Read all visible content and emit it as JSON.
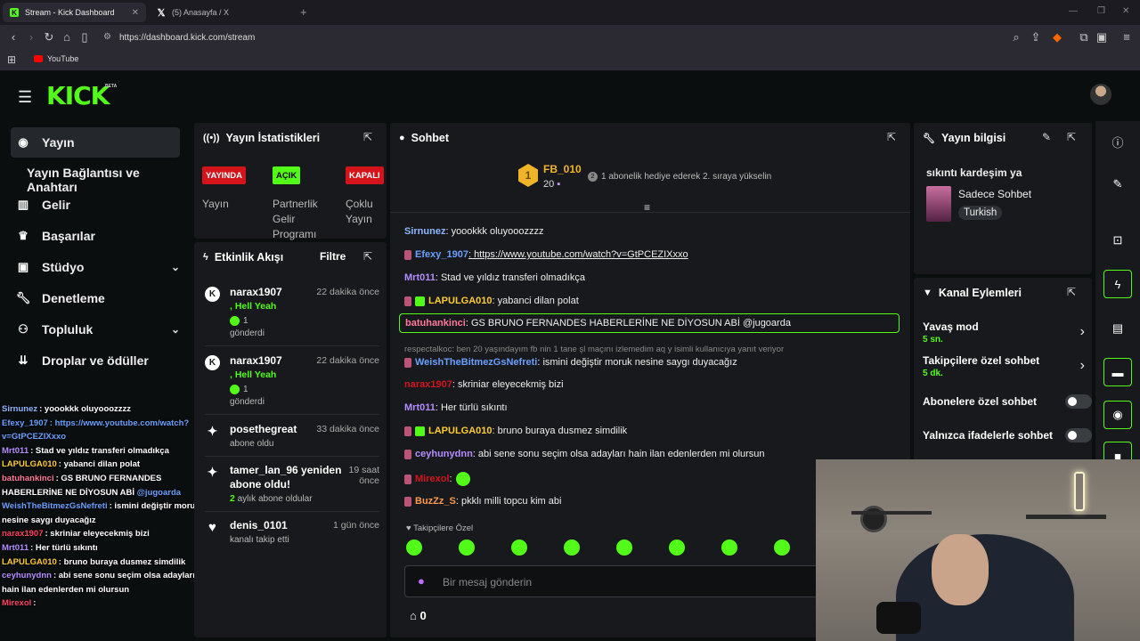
{
  "browser": {
    "tabs": [
      {
        "title": "Stream - Kick Dashboard",
        "icon": "kick-favicon"
      },
      {
        "title": "(5) Anasayfa / X",
        "icon": "x-favicon"
      }
    ],
    "url": "https://dashboard.kick.com/stream",
    "bookmark": "YouTube"
  },
  "header": {
    "logo": "KICK",
    "beta": "BETA"
  },
  "sidebar": {
    "items": [
      {
        "label": "Yayın",
        "icon": "broadcast-icon"
      },
      {
        "label": "Yayın Bağlantısı ve Anahtarı"
      },
      {
        "label": "Gelir",
        "icon": "chart-icon"
      },
      {
        "label": "Başarılar",
        "icon": "trophy-icon"
      },
      {
        "label": "Stüdyo",
        "icon": "studio-icon"
      },
      {
        "label": "Denetleme",
        "icon": "wrench-icon"
      },
      {
        "label": "Topluluk",
        "icon": "community-icon"
      },
      {
        "label": "Droplar ve ödüller",
        "icon": "drops-icon"
      }
    ]
  },
  "overlay_chat": [
    {
      "user": "Sirnunez",
      "color": "#8fb7ff",
      "msg": ": yoookkk oluyooozzzz"
    },
    {
      "user": "Efexy_1907",
      "color": "#6aa0ff",
      "msg": ": https://www.youtube.com/watch?v=GtPCEZIXxxo",
      "msg_color": "#6aa0ff"
    },
    {
      "user": "Mrt011",
      "color": "#b58cff",
      "msg": ": Stad ve yıldız transferi olmadıkça"
    },
    {
      "user": "LAPULGA010",
      "color": "#ffcc33",
      "msg": ": yabanci dilan polat"
    },
    {
      "user": "batuhankinci",
      "color": "#ff7a9a",
      "msg": ": GS BRUNO FERNANDES HABERLERİNE NE DİYOSUN ABİ ",
      "mention": "@jugoarda"
    },
    {
      "user": "WeishTheBitmezGsNefreti",
      "color": "#6aa0ff",
      "msg": ": ismini değiştir moruk nesine saygı duyacağız"
    },
    {
      "user": "narax1907",
      "color": "#ff4060",
      "msg": ": skriniar eleyecekmiş bizi"
    },
    {
      "user": "Mrt011",
      "color": "#b58cff",
      "msg": ": Her türlü sıkıntı"
    },
    {
      "user": "LAPULGA010",
      "color": "#ffcc33",
      "msg": ": bruno buraya dusmez simdilik"
    },
    {
      "user": "ceyhunydnn",
      "color": "#b58cff",
      "msg": ": abi sene sonu seçim olsa adayları hain ilan edenlerden mi olursun"
    },
    {
      "user": "Mirexol",
      "color": "#ff4060",
      "msg": ":"
    }
  ],
  "stats": {
    "title": "Yayın İstatistikleri",
    "badges": [
      {
        "text": "YAYINDA",
        "label": "Yayın",
        "bg": "#d4131b"
      },
      {
        "text": "AÇIK",
        "label": "Partnerlik Gelir Programı",
        "bg": "#53fc18"
      },
      {
        "text": "KAPALI",
        "label": "Çoklu Yayın",
        "bg": "#d4131b"
      }
    ]
  },
  "activity": {
    "title": "Etkinlik Akışı",
    "filter": "Filtre",
    "events": [
      {
        "name": "narax1907",
        "time": "22 dakika önce",
        "extra": ", Hell Yeah",
        "count": "1",
        "action": "gönderdi"
      },
      {
        "name": "narax1907",
        "time": "22 dakika önce",
        "extra": ", Hell Yeah",
        "count": "1",
        "action": "gönderdi"
      },
      {
        "name": "posethegreat",
        "time": "33 dakika önce",
        "action": "abone oldu"
      },
      {
        "name": "tamer_lan_96 yeniden abone oldu!",
        "time": "19 saat önce",
        "months": "2",
        "action": "aylık abone oldular"
      },
      {
        "name": "denis_0101",
        "time": "1 gün önce",
        "action": "kanalı takip etti"
      }
    ]
  },
  "chat": {
    "title": "Sohbet",
    "top_gifter": {
      "rank": "1",
      "name": "FB_010",
      "count": "20"
    },
    "gift_note": "1 abonelik hediye ederek 2. sıraya yükselin",
    "messages": [
      {
        "user": "Sirnunez",
        "color": "#8fb7ff",
        "msg": ": yoookkk oluyooozzzz"
      },
      {
        "user": "Efexy_1907",
        "color": "#6aa0ff",
        "msg": ": https://www.youtube.com/watch?v=GtPCEZIXxxo",
        "link": true
      },
      {
        "user": "Mrt011",
        "color": "#b58cff",
        "msg": ": Stad ve yıldız transferi olmadıkça"
      },
      {
        "user": "LAPULGA010",
        "color": "#ffcc33",
        "msg": ": yabanci dilan polat"
      },
      {
        "user": "batuhankinci",
        "color": "#ff7a9a",
        "msg": ": GS BRUNO FERNANDES HABERLERİNE NE DİYOSUN ABİ @jugoarda"
      },
      {
        "user": "WeishTheBitmezGsNefreti",
        "color": "#6aa0ff",
        "msg": ": ismini değiştir moruk nesine saygı duyacağız",
        "reply": "respectalkoc: ben 20 yaşındayım fb nin 1 tane şl maçını izlemedim aq y isimli kullanıcıya yanıt veriyor"
      },
      {
        "user": "narax1907",
        "color": "#d4131b",
        "msg": ": skriniar eleyecekmiş bizi"
      },
      {
        "user": "Mrt011",
        "color": "#b58cff",
        "msg": ": Her türlü sıkıntı"
      },
      {
        "user": "LAPULGA010",
        "color": "#ffcc33",
        "msg": ": bruno buraya dusmez simdilik"
      },
      {
        "user": "ceyhunydnn",
        "color": "#b58cff",
        "msg": ": abi sene sonu seçim olsa adayları hain ilan edenlerden mi olursun"
      },
      {
        "user": "Mirexol",
        "color": "#d4131b",
        "msg": ":"
      },
      {
        "user": "BuzZz_S",
        "color": "#ff9a4a",
        "msg": ": pkklı milli topcu kim abi"
      }
    ],
    "emote_section": "Takipçilere Özel",
    "input_placeholder": "Bir mesaj gönderin",
    "points": "0"
  },
  "stream_info": {
    "title": "Yayın bilgisi",
    "stream_title": "sıkıntı kardeşim ya",
    "category": "Sadece Sohbet",
    "language": "Turkish"
  },
  "channel_actions": {
    "title": "Kanal Eylemleri",
    "settings": [
      {
        "name": "Yavaş mod",
        "value": "5 sn."
      },
      {
        "name": "Takipçilere özel sohbet",
        "value": "5 dk."
      },
      {
        "name": "Abonelere özel sohbet",
        "enabled": false
      },
      {
        "name": "Yalnızca ifadelerle sohbet",
        "enabled": false
      }
    ]
  },
  "colors": {
    "accent": "#53fc18",
    "live": "#d4131b",
    "panel": "#18191c",
    "bg": "#0b0e0f"
  }
}
